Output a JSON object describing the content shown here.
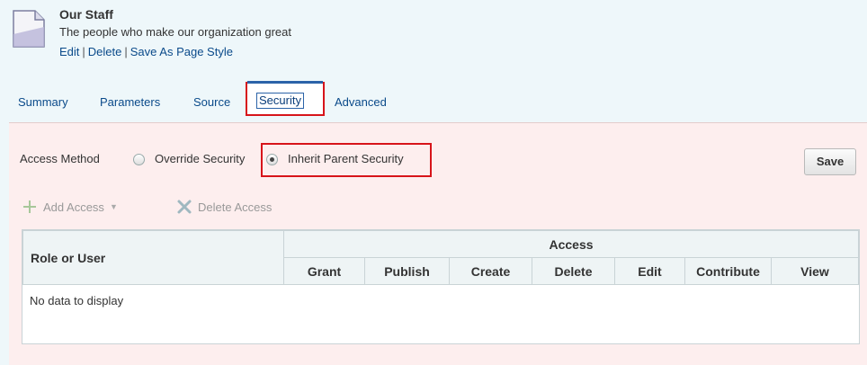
{
  "header": {
    "title": "Our Staff",
    "description": "The people who make our organization great",
    "links": {
      "edit": "Edit",
      "delete": "Delete",
      "save_as_style": "Save As Page Style",
      "separator": "|"
    },
    "icon": "page-icon"
  },
  "tabs": [
    {
      "label": "Summary"
    },
    {
      "label": "Parameters"
    },
    {
      "label": "Source"
    },
    {
      "label": "Security",
      "active": true
    },
    {
      "label": "Advanced"
    }
  ],
  "security": {
    "access_method_label": "Access Method",
    "options": [
      {
        "label": "Override Security",
        "checked": false
      },
      {
        "label": "Inherit Parent Security",
        "checked": true
      }
    ],
    "save_label": "Save",
    "toolbar": {
      "add_access_label": "Add Access",
      "add_access_icon": "plus-icon",
      "delete_access_label": "Delete Access",
      "delete_access_icon": "x-icon"
    },
    "table": {
      "role_header": "Role or User",
      "access_header": "Access",
      "columns": [
        "Grant",
        "Publish",
        "Create",
        "Delete",
        "Edit",
        "Contribute",
        "View"
      ],
      "empty_text": "No data to display"
    }
  },
  "colors": {
    "highlight": "#d7141a",
    "link": "#0a4a8a",
    "panel": "#fdeeee",
    "background": "#eef7fa"
  }
}
